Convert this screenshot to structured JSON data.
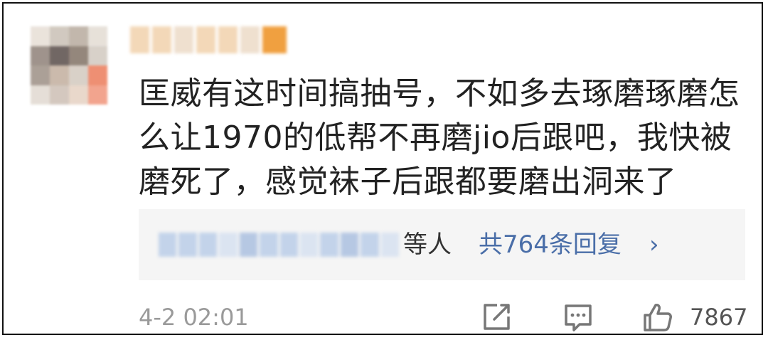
{
  "comment": {
    "text": "匡威有这时间搞抽号，不如多去琢磨琢磨怎么让1970的低帮不再磨jio后跟吧，我快被磨死了，感觉袜子后跟都要磨出洞来了",
    "lines": [
      "匡威有这时间搞抽号，不如多去琢磨琢磨怎",
      "么让1970的低帮不再磨jio后跟吧，我快被",
      "磨死了，感觉袜子后跟都要磨出洞来了"
    ]
  },
  "replies": {
    "suffix": "等人",
    "total_label": "共764条回复",
    "chevron": "›"
  },
  "footer": {
    "timestamp": "4-2 02:01",
    "like_count": "7867",
    "icons": [
      "share-icon",
      "comment-icon",
      "like-icon"
    ]
  },
  "colors": {
    "text": "#222222",
    "link": "#4a6ea8",
    "muted": "#9a9a9a",
    "reply_bg": "#f5f5f5"
  }
}
